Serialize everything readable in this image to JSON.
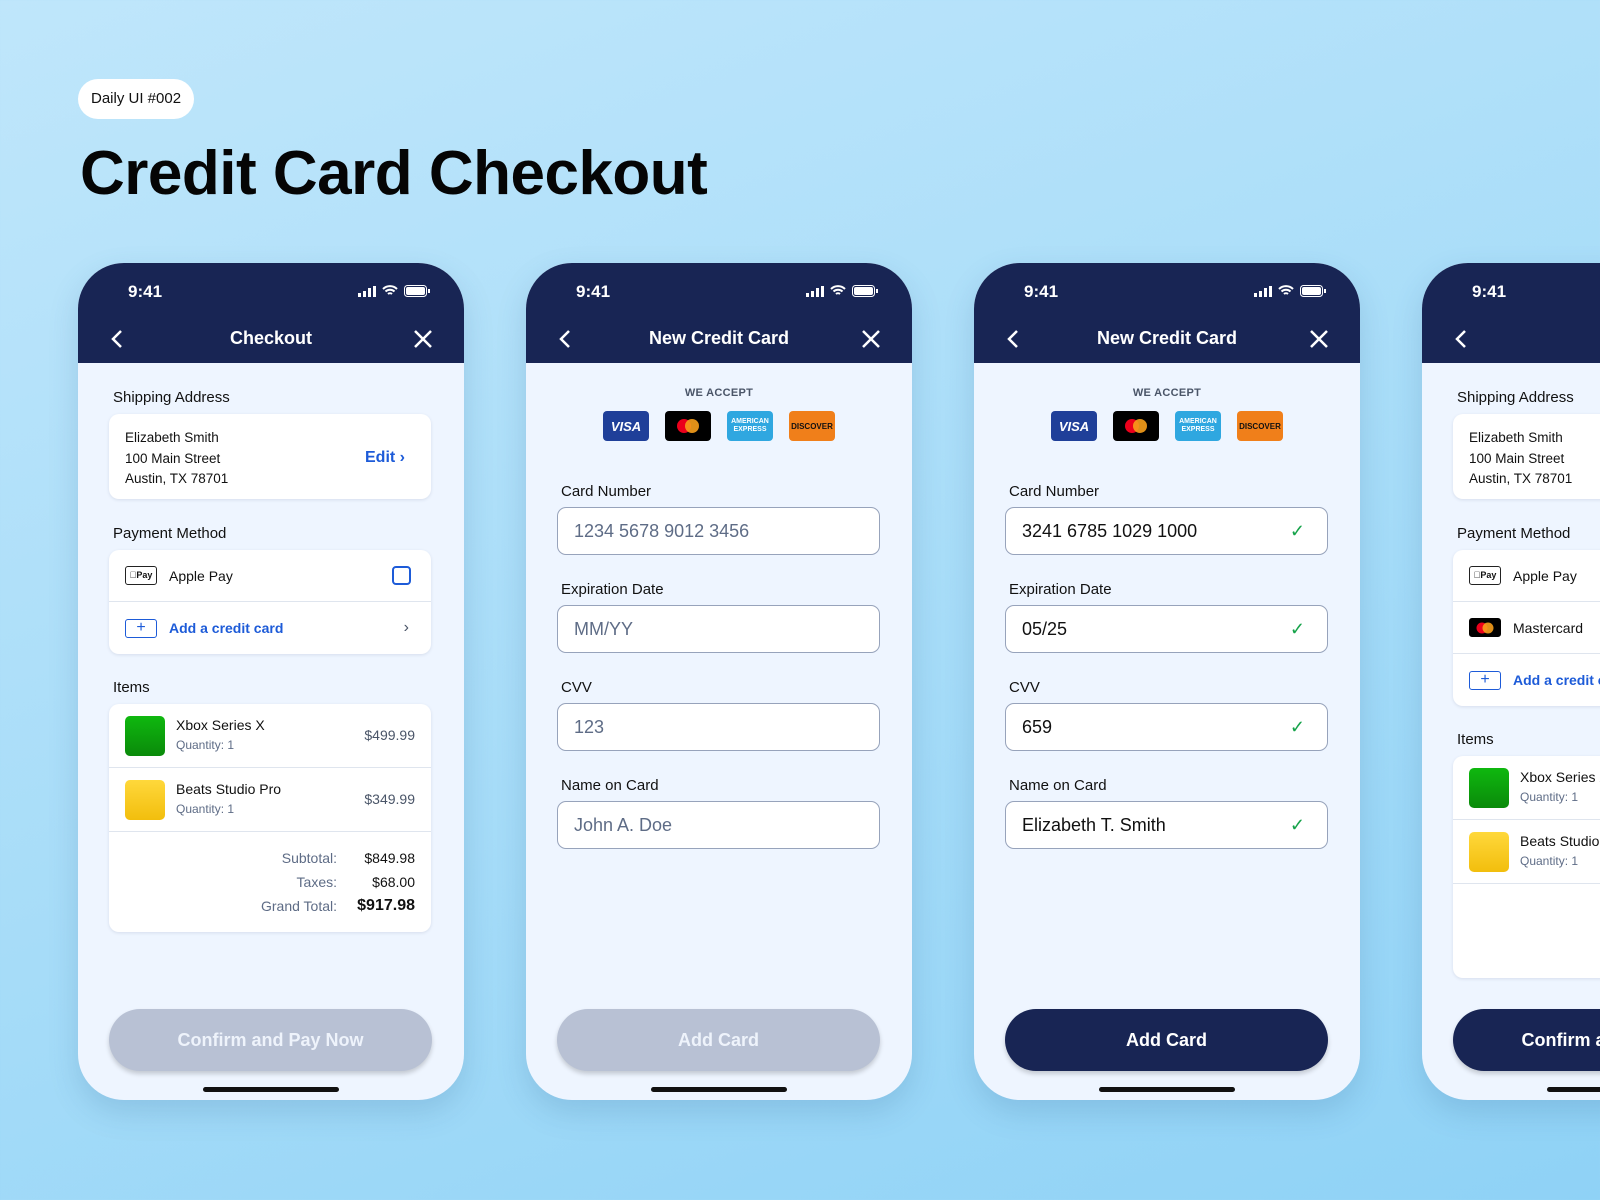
{
  "page": {
    "tag": "Daily UI #002",
    "title": "Credit Card Checkout"
  },
  "status_time": "9:41",
  "colors": {
    "navy": "#182554",
    "link_blue": "#1d5bd8",
    "success_green": "#16a34a",
    "disabled_button": "#b8c1d4"
  },
  "checkout": {
    "nav_title": "Checkout",
    "shipping_label": "Shipping Address",
    "address": [
      "Elizabeth Smith",
      "100 Main Street",
      "Austin, TX 78701"
    ],
    "edit_label": "Edit",
    "payment_label": "Payment Method",
    "payment_options": [
      {
        "icon": "apple-pay-icon",
        "label": "Apple Pay",
        "badge": "Pay"
      },
      {
        "icon": "plus-icon",
        "label": "Add a credit card"
      }
    ],
    "items_label": "Items",
    "items": [
      {
        "name": "Xbox Series X",
        "quantity": "Quantity: 1",
        "price": "$499.99"
      },
      {
        "name": "Beats Studio Pro",
        "quantity": "Quantity: 1",
        "price": "$349.99"
      }
    ],
    "totals": [
      {
        "label": "Subtotal:",
        "value": "$849.98"
      },
      {
        "label": "Taxes:",
        "value": "$68.00"
      },
      {
        "label": "Grand Total:",
        "value": "$917.98"
      }
    ],
    "button": "Confirm and Pay Now"
  },
  "new_card": {
    "nav_title": "New Credit Card",
    "we_accept": "WE ACCEPT",
    "logos": {
      "visa": "VISA",
      "amex": "AMERICAN EXPRESS",
      "discover": "DISCOVER"
    },
    "fields": [
      {
        "label": "Card Number",
        "placeholder": "1234 5678 9012 3456",
        "value": "3241 6785 1029 1000"
      },
      {
        "label": "Expiration Date",
        "placeholder": "MM/YY",
        "value": "05/25"
      },
      {
        "label": "CVV",
        "placeholder": "123",
        "value": "659"
      },
      {
        "label": "Name on Card",
        "placeholder": "John A. Doe",
        "value": "Elizabeth T. Smith"
      }
    ],
    "button": "Add Card"
  },
  "checkout_final": {
    "payment_options": [
      "Apple Pay",
      "Mastercard",
      "Add a credit card"
    ],
    "button": "Confirm and Pay Now"
  }
}
